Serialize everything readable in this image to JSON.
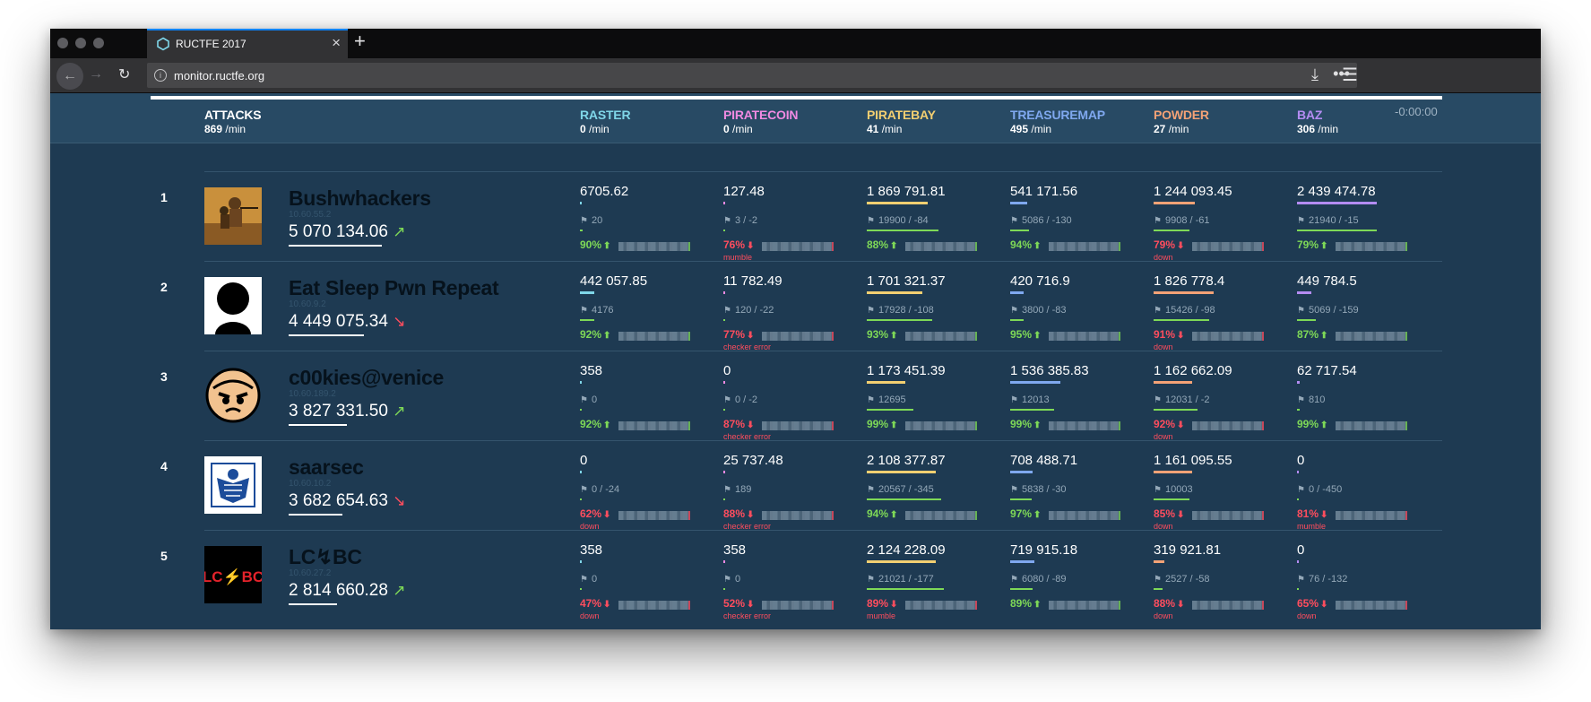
{
  "browser": {
    "tab_title": "RUCTFE 2017",
    "url": "monitor.ructfe.org"
  },
  "header": {
    "timer": "-0:00:00",
    "unit": "/min",
    "attacks": {
      "label": "ATTACKS",
      "rate": "869"
    },
    "services": [
      {
        "name": "RASTER",
        "rate": "0",
        "color": "#7fd6e8"
      },
      {
        "name": "PIRATECOIN",
        "rate": "0",
        "color": "#f08ae2"
      },
      {
        "name": "PIRATEBAY",
        "rate": "41",
        "color": "#f3cf71"
      },
      {
        "name": "TREASUREMAP",
        "rate": "495",
        "color": "#7fa8ef"
      },
      {
        "name": "POWDER",
        "rate": "27",
        "color": "#f4a276"
      },
      {
        "name": "BAZ",
        "rate": "306",
        "color": "#b48cf2"
      }
    ]
  },
  "teams": [
    {
      "rank": "1",
      "name": "Bushwhackers",
      "ip": "10.60.55.2",
      "score": "5 070 134.06",
      "trend": "up",
      "trend_glyph": "↗",
      "score_bar_fraction": 0.96,
      "avatar": "photo-icon",
      "services": [
        {
          "score": "6705.62",
          "score_fraction": 0.01,
          "flags": "20",
          "flags_fraction": 0.02,
          "sla": "90%",
          "sla_state": "up",
          "status": ""
        },
        {
          "score": "127.48",
          "score_fraction": 0.01,
          "flags": "3 / -2",
          "flags_fraction": 0.01,
          "sla": "76%",
          "sla_state": "down",
          "status": "mumble"
        },
        {
          "score": "1 869 791.81",
          "score_fraction": 0.46,
          "flags": "19900 / -84",
          "flags_fraction": 0.54,
          "sla": "88%",
          "sla_state": "up",
          "status": ""
        },
        {
          "score": "541 171.56",
          "score_fraction": 0.13,
          "flags": "5086 / -130",
          "flags_fraction": 0.14,
          "sla": "94%",
          "sla_state": "up",
          "status": ""
        },
        {
          "score": "1 244 093.45",
          "score_fraction": 0.31,
          "flags": "9908 / -61",
          "flags_fraction": 0.27,
          "sla": "79%",
          "sla_state": "down",
          "status": "down"
        },
        {
          "score": "2 439 474.78",
          "score_fraction": 0.6,
          "flags": "21940 / -15",
          "flags_fraction": 0.6,
          "sla": "79%",
          "sla_state": "up",
          "status": ""
        }
      ]
    },
    {
      "rank": "2",
      "name": "Eat Sleep Pwn Repeat",
      "ip": "10.60.9.2",
      "score": "4 449 075.34",
      "trend": "down",
      "trend_glyph": "↘",
      "score_bar_fraction": 0.78,
      "avatar": "user-silhouette-icon",
      "services": [
        {
          "score": "442 057.85",
          "score_fraction": 0.11,
          "flags": "4176",
          "flags_fraction": 0.11,
          "sla": "92%",
          "sla_state": "up",
          "status": ""
        },
        {
          "score": "11 782.49",
          "score_fraction": 0.01,
          "flags": "120 / -22",
          "flags_fraction": 0.01,
          "sla": "77%",
          "sla_state": "down",
          "status": "checker error"
        },
        {
          "score": "1 701 321.37",
          "score_fraction": 0.42,
          "flags": "17928 / -108",
          "flags_fraction": 0.49,
          "sla": "93%",
          "sla_state": "up",
          "status": ""
        },
        {
          "score": "420 716.9",
          "score_fraction": 0.1,
          "flags": "3800 / -83",
          "flags_fraction": 0.1,
          "sla": "95%",
          "sla_state": "up",
          "status": ""
        },
        {
          "score": "1 826 778.4",
          "score_fraction": 0.45,
          "flags": "15426 / -98",
          "flags_fraction": 0.42,
          "sla": "91%",
          "sla_state": "down",
          "status": "down"
        },
        {
          "score": "449 784.5",
          "score_fraction": 0.11,
          "flags": "5069 / -159",
          "flags_fraction": 0.14,
          "sla": "87%",
          "sla_state": "up",
          "status": ""
        }
      ]
    },
    {
      "rank": "3",
      "name": "c00kies@venice",
      "ip": "10.60.189.2",
      "score": "3 827 331.50",
      "trend": "up",
      "trend_glyph": "↗",
      "score_bar_fraction": 0.6,
      "avatar": "angry-cookie-face-icon",
      "services": [
        {
          "score": "358",
          "score_fraction": 0.01,
          "flags": "0",
          "flags_fraction": 0.0,
          "sla": "92%",
          "sla_state": "up",
          "status": ""
        },
        {
          "score": "0",
          "score_fraction": 0.0,
          "flags": "0 / -2",
          "flags_fraction": 0.0,
          "sla": "87%",
          "sla_state": "down",
          "status": "checker error"
        },
        {
          "score": "1 173 451.39",
          "score_fraction": 0.29,
          "flags": "12695",
          "flags_fraction": 0.35,
          "sla": "99%",
          "sla_state": "up",
          "status": ""
        },
        {
          "score": "1 536 385.83",
          "score_fraction": 0.38,
          "flags": "12013",
          "flags_fraction": 0.33,
          "sla": "99%",
          "sla_state": "up",
          "status": ""
        },
        {
          "score": "1 162 662.09",
          "score_fraction": 0.29,
          "flags": "12031 / -2",
          "flags_fraction": 0.33,
          "sla": "92%",
          "sla_state": "down",
          "status": "down"
        },
        {
          "score": "62 717.54",
          "score_fraction": 0.02,
          "flags": "810",
          "flags_fraction": 0.02,
          "sla": "99%",
          "sla_state": "up",
          "status": ""
        }
      ]
    },
    {
      "rank": "4",
      "name": "saarsec",
      "ip": "10.60.10.2",
      "score": "3 682 654.63",
      "trend": "down",
      "trend_glyph": "↘",
      "score_bar_fraction": 0.56,
      "avatar": "eagle-crest-icon",
      "services": [
        {
          "score": "0",
          "score_fraction": 0.0,
          "flags": "0 / -24",
          "flags_fraction": 0.0,
          "sla": "62%",
          "sla_state": "down",
          "status": "down"
        },
        {
          "score": "25 737.48",
          "score_fraction": 0.01,
          "flags": "189",
          "flags_fraction": 0.01,
          "sla": "88%",
          "sla_state": "down",
          "status": "checker error"
        },
        {
          "score": "2 108 377.87",
          "score_fraction": 0.52,
          "flags": "20567 / -345",
          "flags_fraction": 0.56,
          "sla": "94%",
          "sla_state": "up",
          "status": ""
        },
        {
          "score": "708 488.71",
          "score_fraction": 0.17,
          "flags": "5838 / -30",
          "flags_fraction": 0.16,
          "sla": "97%",
          "sla_state": "up",
          "status": ""
        },
        {
          "score": "1 161 095.55",
          "score_fraction": 0.29,
          "flags": "10003",
          "flags_fraction": 0.27,
          "sla": "85%",
          "sla_state": "down",
          "status": "down"
        },
        {
          "score": "0",
          "score_fraction": 0.0,
          "flags": "0 / -450",
          "flags_fraction": 0.0,
          "sla": "81%",
          "sla_state": "down",
          "status": "mumble"
        }
      ]
    },
    {
      "rank": "5",
      "name": "LC↯BC",
      "ip": "10.60.27.2",
      "score": "2 814 660.28",
      "trend": "up",
      "trend_glyph": "↗",
      "score_bar_fraction": 0.5,
      "avatar": "lcbc-logo-icon",
      "services": [
        {
          "score": "358",
          "score_fraction": 0.01,
          "flags": "0",
          "flags_fraction": 0.0,
          "sla": "47%",
          "sla_state": "down",
          "status": "down"
        },
        {
          "score": "358",
          "score_fraction": 0.01,
          "flags": "0",
          "flags_fraction": 0.0,
          "sla": "52%",
          "sla_state": "down",
          "status": "checker error"
        },
        {
          "score": "2 124 228.09",
          "score_fraction": 0.52,
          "flags": "21021 / -177",
          "flags_fraction": 0.58,
          "sla": "89%",
          "sla_state": "down",
          "status": "mumble"
        },
        {
          "score": "719 915.18",
          "score_fraction": 0.18,
          "flags": "6080 / -89",
          "flags_fraction": 0.17,
          "sla": "89%",
          "sla_state": "up",
          "status": ""
        },
        {
          "score": "319 921.81",
          "score_fraction": 0.08,
          "flags": "2527 / -58",
          "flags_fraction": 0.07,
          "sla": "88%",
          "sla_state": "down",
          "status": "down"
        },
        {
          "score": "0",
          "score_fraction": 0.0,
          "flags": "76 / -132",
          "flags_fraction": 0.0,
          "sla": "65%",
          "sla_state": "down",
          "status": "down"
        }
      ]
    }
  ]
}
